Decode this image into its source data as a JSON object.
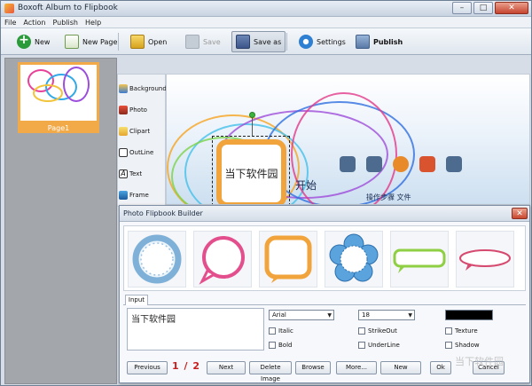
{
  "window": {
    "title": "Boxoft Album to Flipbook"
  },
  "menu": [
    "File",
    "Action",
    "Publish",
    "Help"
  ],
  "toolbar": {
    "new": "New",
    "new_page": "New Page",
    "open": "Open",
    "save": "Save",
    "save_as": "Save as",
    "settings": "Settings",
    "publish": "Publish"
  },
  "pages": [
    {
      "label": "Page1"
    }
  ],
  "assets": [
    "Background",
    "Photo",
    "Clipart",
    "OutLine",
    "Text",
    "Frame"
  ],
  "canvas": {
    "text_box": "当下软件园",
    "bg_text_1": "开始",
    "bg_text_2": "操作步骤 文件"
  },
  "dialog": {
    "title": "Photo Flipbook Builder",
    "tab": "Input",
    "input_value": "当下软件园",
    "font": "Arial",
    "size": "18",
    "checks": [
      "Italic",
      "StrikeOut",
      "Texture",
      "Bold",
      "UnderLine",
      "Shadow"
    ],
    "pager": "1 / 2",
    "buttons": {
      "previous": "Previous",
      "next": "Next",
      "delete_image": "Delete Image",
      "browse": "Browse",
      "more": "More...",
      "new": "New",
      "ok": "Ok",
      "cancel": "Cancel"
    }
  },
  "watermark": "当下软件园",
  "colors": {
    "accent_orange": "#f2a43c",
    "pager_red": "#c81e1e"
  }
}
